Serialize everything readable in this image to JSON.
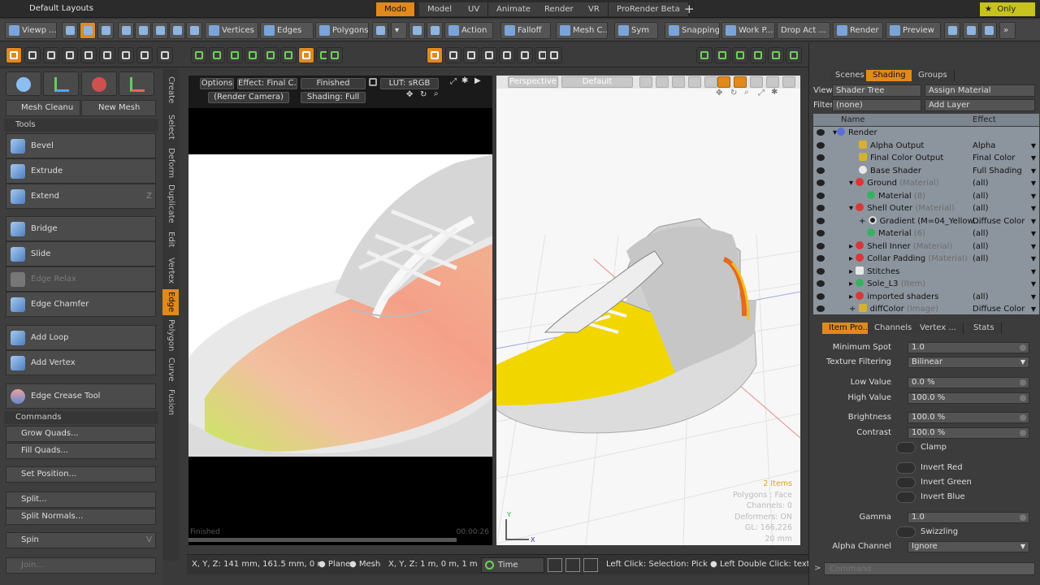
{
  "title_bar": {
    "title": "Default Layouts",
    "tabs": [
      "Modo",
      "Model",
      "UV",
      "Animate",
      "Render",
      "VR",
      "ProRender Beta"
    ],
    "active_tab": "Modo",
    "only_label": "Only"
  },
  "toolbar1": {
    "buttons": [
      "Viewp ...",
      "Vertices",
      "Edges",
      "Polygons",
      "Action",
      "Falloff",
      "Mesh C...",
      "Sym",
      "Snapping",
      "Work P...",
      "Drop Act ...",
      "Render",
      "Preview"
    ]
  },
  "left_panel": {
    "mesh_cleanup": "Mesh Cleanu ...",
    "new_mesh": "New Mesh",
    "tools_header": "Tools",
    "tools": [
      "Bevel",
      "Extrude",
      "Extend",
      "Bridge",
      "Slide",
      "Edge Relax",
      "Edge Chamfer",
      "Add Loop",
      "Add Vertex",
      "Edge Crease Tool"
    ],
    "extend_key": "Z",
    "commands_header": "Commands",
    "commands": [
      "Grow Quads...",
      "Fill Quads...",
      "Set Position...",
      "Split...",
      "Split Normals...",
      "Spin",
      "Join..."
    ],
    "spin_key": "V"
  },
  "vertical_tabs": [
    "Create",
    "Select",
    "Deform",
    "Duplicate",
    "Edit",
    "Vertex",
    "Edge",
    "Polygon",
    "Curve",
    "Fusion"
  ],
  "active_vertical_tab": "Edge",
  "render_view": {
    "options": "Options",
    "effect": "Effect: Final C...",
    "status": "Finished",
    "lut": "LUT: sRGB",
    "camera": "(Render Camera)",
    "shading": "Shading: Full",
    "footer_status": "Finished",
    "footer_time": "00:00:26"
  },
  "viewport": {
    "view": "Perspective",
    "style": "Default",
    "info": [
      "2 Items",
      "Polygons : Face",
      "Channels: 0",
      "Deformers: ON",
      "GL: 166,226",
      "20 mm"
    ]
  },
  "status_bar": {
    "coords": "X, Y, Z:  141 mm, 161.5 mm, 0 m",
    "plane": "Plane",
    "mesh": "Mesh",
    "xyz": "X, Y, Z:  1 m, 0 m, 1 m",
    "time": "Time",
    "hint": "Left Click: Selection: Pick  ●  Left Double Click: textu ..."
  },
  "right_panel": {
    "tabs": [
      "Scenes",
      "Shading",
      "Groups"
    ],
    "active_tab": "Shading",
    "view_label": "View",
    "view_value": "Shader Tree",
    "assign_material": "Assign Material",
    "filter_label": "Filter",
    "filter_value": "(none)",
    "add_layer": "Add Layer",
    "tree_headers": [
      "Name",
      "Effect"
    ],
    "tree": [
      {
        "name": "Render",
        "tag": "",
        "effect": "",
        "color": "#5a6fd8"
      },
      {
        "name": "Alpha Output",
        "tag": "",
        "effect": "Alpha",
        "color": "#d8b030"
      },
      {
        "name": "Final Color Output",
        "tag": "",
        "effect": "Final Color",
        "color": "#d8b030"
      },
      {
        "name": "Base Shader",
        "tag": "",
        "effect": "Full Shading",
        "color": "#e8e8e8"
      },
      {
        "name": "Ground",
        "tag": "(Material)",
        "effect": "(all)",
        "color": "#d83838"
      },
      {
        "name": "Material",
        "tag": "(8)",
        "effect": "(all)",
        "color": "#38b060"
      },
      {
        "name": "Shell Outer",
        "tag": "(Material)",
        "effect": "(all)",
        "color": "#d83838"
      },
      {
        "name": "Gradient (M=04_Yellow...",
        "tag": "",
        "effect": "Diffuse Color",
        "color": "#222222"
      },
      {
        "name": "Material",
        "tag": "(6)",
        "effect": "(all)",
        "color": "#38b060"
      },
      {
        "name": "Shell Inner",
        "tag": "(Material)",
        "effect": "(all)",
        "color": "#d83838"
      },
      {
        "name": "Collar Padding",
        "tag": "(Material)",
        "effect": "(all)",
        "color": "#d83838"
      },
      {
        "name": "Stitches",
        "tag": "",
        "effect": "",
        "color": "#e8e8e8"
      },
      {
        "name": "Sole_L3",
        "tag": "(Item)",
        "effect": "",
        "color": "#38b060"
      },
      {
        "name": "imported shaders",
        "tag": "",
        "effect": "(all)",
        "color": "#d83838"
      },
      {
        "name": "diffColor",
        "tag": "(Image)",
        "effect": "Diffuse Color",
        "color": "#d8b030"
      }
    ],
    "prop_tabs": [
      "Item Pro...",
      "Channels",
      "Vertex ...",
      "Stats"
    ],
    "active_prop_tab": "Item Pro...",
    "props": {
      "minimum_spot_label": "Minimum Spot",
      "minimum_spot": "1.0",
      "texture_filtering_label": "Texture Filtering",
      "texture_filtering": "Bilinear",
      "low_value_label": "Low Value",
      "low_value": "0.0 %",
      "high_value_label": "High Value",
      "high_value": "100.0 %",
      "brightness_label": "Brightness",
      "brightness": "100.0 %",
      "contrast_label": "Contrast",
      "contrast": "100.0 %",
      "clamp": "Clamp",
      "invert_red": "Invert Red",
      "invert_green": "Invert Green",
      "invert_blue": "Invert Blue",
      "gamma_label": "Gamma",
      "gamma": "1.0",
      "swizzling": "Swizzling",
      "alpha_channel_label": "Alpha Channel",
      "alpha_channel": "Ignore"
    },
    "command_placeholder": "Command"
  }
}
